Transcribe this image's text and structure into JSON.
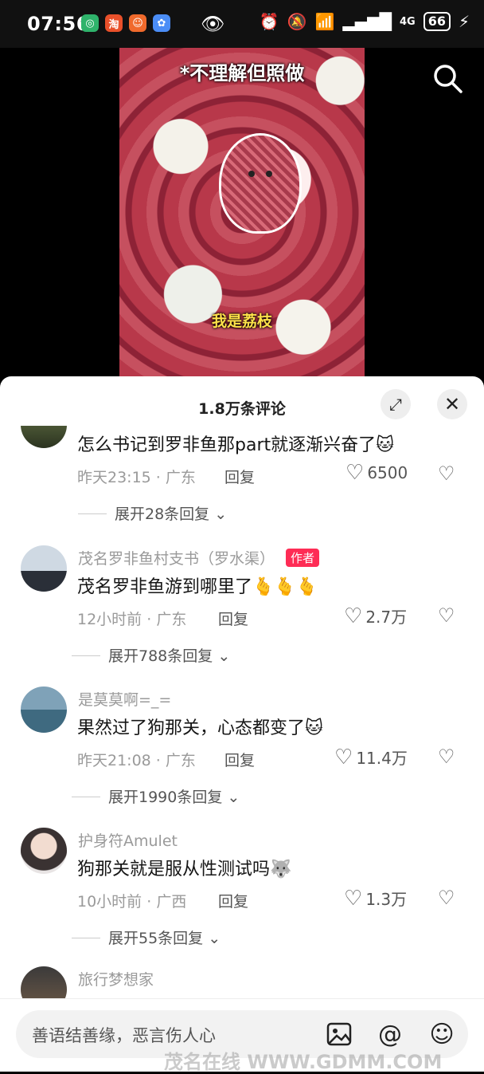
{
  "status_bar": {
    "time": "07:56",
    "signal": "4G",
    "battery": "66"
  },
  "video": {
    "caption_top": "*不理解但照做",
    "caption_bottom": "我是荔枝"
  },
  "comments_sheet": {
    "title": "1.8万条评论",
    "comments": [
      {
        "user": "",
        "text": "怎么书记到罗非鱼那part就逐渐兴奋了",
        "emoji": "🐱",
        "time": "昨天23:15",
        "location": "广东",
        "reply_label": "回复",
        "likes": "6500",
        "expand": "展开28条回复"
      },
      {
        "user": "茂名罗非鱼村支书（罗水渠）",
        "author_tag": "作者",
        "text": "茂名罗非鱼游到哪里了",
        "emoji": "🫰🫰🫰",
        "time": "12小时前",
        "location": "广东",
        "reply_label": "回复",
        "likes": "2.7万",
        "expand": "展开788条回复"
      },
      {
        "user": "是莫莫啊=_=",
        "text": "果然过了狗那关，心态都变了",
        "emoji": "🐱",
        "time": "昨天21:08",
        "location": "广东",
        "reply_label": "回复",
        "likes": "11.4万",
        "expand": "展开1990条回复"
      },
      {
        "user": "护身符Amulet",
        "text": "狗那关就是服从性测试吗",
        "emoji": "🐺",
        "time": "10小时前",
        "location": "广西",
        "reply_label": "回复",
        "likes": "1.3万",
        "expand": "展开55条回复"
      },
      {
        "user": "旅行梦想家"
      }
    ]
  },
  "input_bar": {
    "placeholder": "善语结善缘，恶言伤人心"
  },
  "watermark": "茂名在线 WWW.GDMM.COM"
}
